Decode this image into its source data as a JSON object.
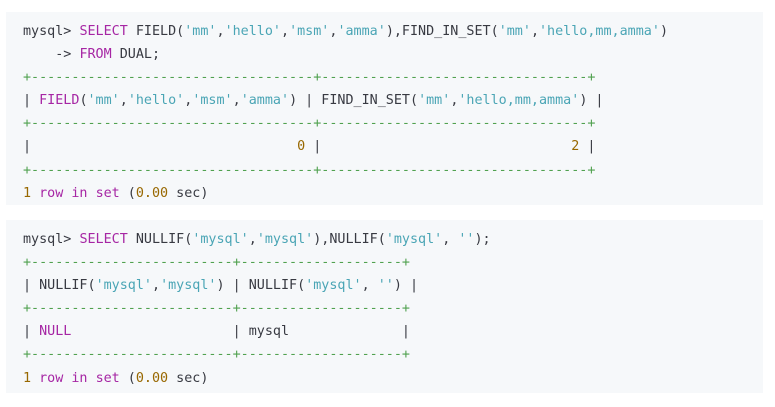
{
  "blocks": [
    {
      "lines": [
        [
          {
            "t": "mysql> ",
            "c": "txt"
          },
          {
            "t": "SELECT",
            "c": "kw"
          },
          {
            "t": " FIELD(",
            "c": "txt"
          },
          {
            "t": "'mm'",
            "c": "strb"
          },
          {
            "t": ",",
            "c": "txt"
          },
          {
            "t": "'hello'",
            "c": "strb"
          },
          {
            "t": ",",
            "c": "txt"
          },
          {
            "t": "'msm'",
            "c": "strb"
          },
          {
            "t": ",",
            "c": "txt"
          },
          {
            "t": "'amma'",
            "c": "strb"
          },
          {
            "t": "),FIND_IN_SET(",
            "c": "txt"
          },
          {
            "t": "'mm'",
            "c": "strb"
          },
          {
            "t": ",",
            "c": "txt"
          },
          {
            "t": "'hello,mm,amma'",
            "c": "strb"
          },
          {
            "t": ")",
            "c": "txt"
          }
        ],
        [
          {
            "t": "    -> ",
            "c": "txt"
          },
          {
            "t": "FROM",
            "c": "kw"
          },
          {
            "t": " DUAL;",
            "c": "txt"
          }
        ],
        [
          {
            "t": "+-----------------------------------+---------------------------------+",
            "c": "sep"
          }
        ],
        [
          {
            "t": "| ",
            "c": "txt"
          },
          {
            "t": "FIELD",
            "c": "kw"
          },
          {
            "t": "(",
            "c": "txt"
          },
          {
            "t": "'mm'",
            "c": "strb"
          },
          {
            "t": ",",
            "c": "txt"
          },
          {
            "t": "'hello'",
            "c": "strb"
          },
          {
            "t": ",",
            "c": "txt"
          },
          {
            "t": "'msm'",
            "c": "strb"
          },
          {
            "t": ",",
            "c": "txt"
          },
          {
            "t": "'amma'",
            "c": "strb"
          },
          {
            "t": ") | FIND_IN_SET(",
            "c": "txt"
          },
          {
            "t": "'mm'",
            "c": "strb"
          },
          {
            "t": ",",
            "c": "txt"
          },
          {
            "t": "'hello,mm,amma'",
            "c": "strb"
          },
          {
            "t": ") |",
            "c": "txt"
          }
        ],
        [
          {
            "t": "+-----------------------------------+---------------------------------+",
            "c": "sep"
          }
        ],
        [
          {
            "t": "|                                 ",
            "c": "txt"
          },
          {
            "t": "0",
            "c": "num"
          },
          {
            "t": " |                               ",
            "c": "txt"
          },
          {
            "t": "2",
            "c": "num"
          },
          {
            "t": " |",
            "c": "txt"
          }
        ],
        [
          {
            "t": "+-----------------------------------+---------------------------------+",
            "c": "sep"
          }
        ],
        [
          {
            "t": "1",
            "c": "num"
          },
          {
            "t": " ",
            "c": "txt"
          },
          {
            "t": "row",
            "c": "kw"
          },
          {
            "t": " ",
            "c": "txt"
          },
          {
            "t": "in",
            "c": "kw"
          },
          {
            "t": " ",
            "c": "txt"
          },
          {
            "t": "set",
            "c": "kw"
          },
          {
            "t": " (",
            "c": "txt"
          },
          {
            "t": "0.00",
            "c": "num"
          },
          {
            "t": " sec)",
            "c": "txt"
          }
        ]
      ]
    },
    {
      "lines": [
        [
          {
            "t": "mysql> ",
            "c": "txt"
          },
          {
            "t": "SELECT",
            "c": "kw"
          },
          {
            "t": " NULLIF(",
            "c": "txt"
          },
          {
            "t": "'mysql'",
            "c": "strb"
          },
          {
            "t": ",",
            "c": "txt"
          },
          {
            "t": "'mysql'",
            "c": "strb"
          },
          {
            "t": "),NULLIF(",
            "c": "txt"
          },
          {
            "t": "'mysql'",
            "c": "strb"
          },
          {
            "t": ", ",
            "c": "txt"
          },
          {
            "t": "''",
            "c": "strb"
          },
          {
            "t": ");",
            "c": "txt"
          }
        ],
        [
          {
            "t": "+-------------------------+--------------------+",
            "c": "sep"
          }
        ],
        [
          {
            "t": "| NULLIF(",
            "c": "txt"
          },
          {
            "t": "'mysql'",
            "c": "strb"
          },
          {
            "t": ",",
            "c": "txt"
          },
          {
            "t": "'mysql'",
            "c": "strb"
          },
          {
            "t": ") | NULLIF(",
            "c": "txt"
          },
          {
            "t": "'mysql'",
            "c": "strb"
          },
          {
            "t": ", ",
            "c": "txt"
          },
          {
            "t": "''",
            "c": "strb"
          },
          {
            "t": ") |",
            "c": "txt"
          }
        ],
        [
          {
            "t": "+-------------------------+--------------------+",
            "c": "sep"
          }
        ],
        [
          {
            "t": "| ",
            "c": "txt"
          },
          {
            "t": "NULL",
            "c": "kw"
          },
          {
            "t": "                    | mysql              |",
            "c": "txt"
          }
        ],
        [
          {
            "t": "+-------------------------+--------------------+",
            "c": "sep"
          }
        ],
        [
          {
            "t": "1",
            "c": "num"
          },
          {
            "t": " ",
            "c": "txt"
          },
          {
            "t": "row",
            "c": "kw"
          },
          {
            "t": " ",
            "c": "txt"
          },
          {
            "t": "in",
            "c": "kw"
          },
          {
            "t": " ",
            "c": "txt"
          },
          {
            "t": "set",
            "c": "kw"
          },
          {
            "t": " (",
            "c": "txt"
          },
          {
            "t": "0.00",
            "c": "num"
          },
          {
            "t": " sec)",
            "c": "txt"
          }
        ]
      ]
    }
  ],
  "colors": {
    "keyword": "#a626a4",
    "string": "#4aa5b5",
    "number": "#986801",
    "separator": "#50a14f",
    "text": "#383a42",
    "block_bg": "#f6f8fa"
  }
}
